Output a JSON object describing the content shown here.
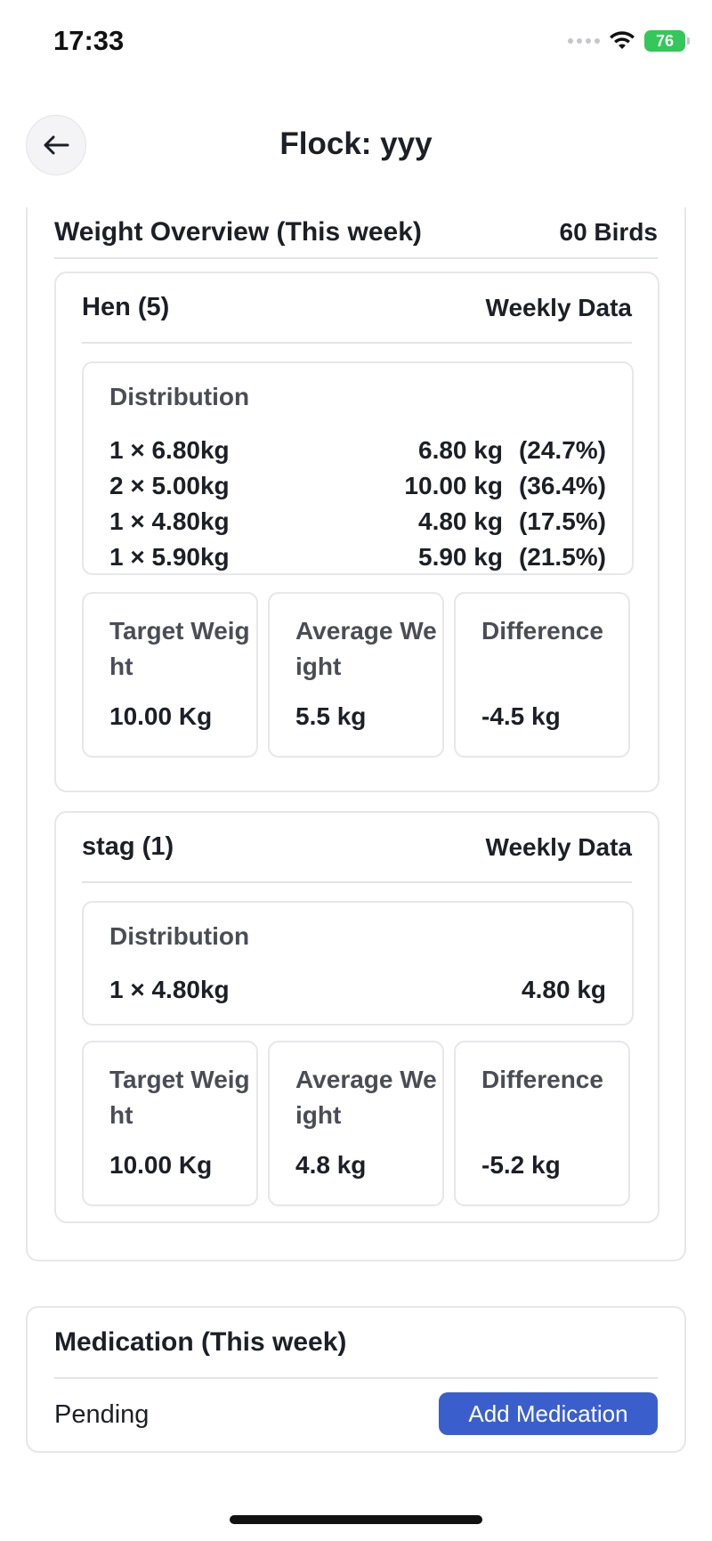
{
  "status_bar": {
    "time": "17:33",
    "battery": "76",
    "icons": [
      "cellular-signal-icon",
      "wifi-icon",
      "battery-charging-icon"
    ]
  },
  "header": {
    "title": "Flock: yyy",
    "back_icon": "arrow-left-icon"
  },
  "weight_overview": {
    "title": "Weight Overview (This week)",
    "bird_count": "60 Birds",
    "groups": [
      {
        "name": "Hen (5)",
        "meta": "Weekly Data",
        "distribution_title": "Distribution",
        "distribution": [
          {
            "item": "1 × 6.80kg",
            "total": "6.80 kg",
            "percent": "(24.7%)"
          },
          {
            "item": "2 × 5.00kg",
            "total": "10.00 kg",
            "percent": "(36.4%)"
          },
          {
            "item": "1 × 4.80kg",
            "total": "4.80 kg",
            "percent": "(17.5%)"
          },
          {
            "item": "1 × 5.90kg",
            "total": "5.90 kg",
            "percent": "(21.5%)"
          }
        ],
        "stats": [
          {
            "label": "Target Weight",
            "value": "10.00 Kg"
          },
          {
            "label": "Average Weight",
            "value": "5.5 kg"
          },
          {
            "label": "Difference",
            "value": "-4.5 kg"
          }
        ]
      },
      {
        "name": "stag (1)",
        "meta": "Weekly Data",
        "distribution_title": "Distribution",
        "distribution": [
          {
            "item": "1 × 4.80kg",
            "total": "4.80 kg"
          }
        ],
        "stats": [
          {
            "label": "Target Weight",
            "value": "10.00 Kg"
          },
          {
            "label": "Average Weight",
            "value": "4.8 kg"
          },
          {
            "label": "Difference",
            "value": "-5.2 kg"
          }
        ]
      }
    ]
  },
  "medication": {
    "title": "Medication (This week)",
    "status": "Pending",
    "add_button_label": "Add Medication"
  },
  "colors": {
    "accent": "#3a5fcd",
    "battery": "#34c759",
    "border": "#e6e7ea"
  }
}
